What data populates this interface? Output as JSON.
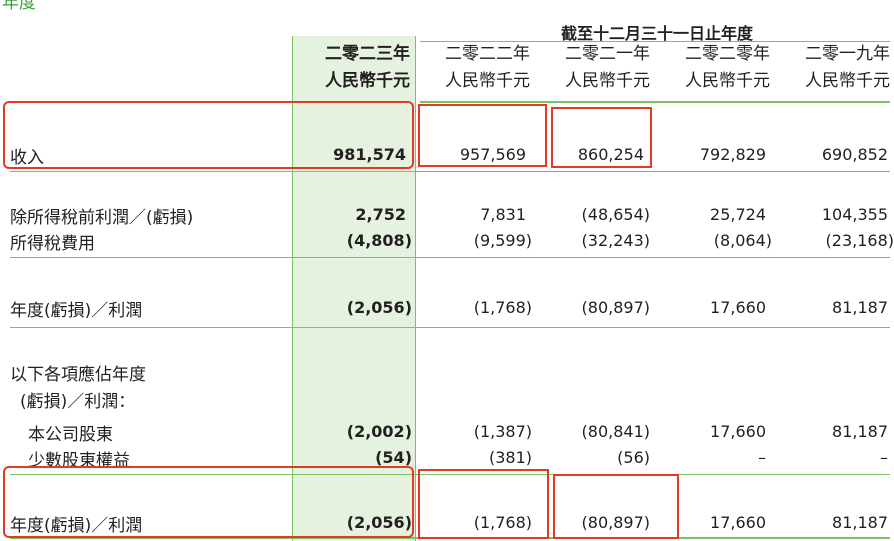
{
  "header": {
    "top_tag": "年度",
    "period_title": "截至十二月三十一日止年度",
    "columns": [
      {
        "year": "二零二三年",
        "unit": "人民幣千元",
        "highlight": true
      },
      {
        "year": "二零二二年",
        "unit": "人民幣千元",
        "highlight": false
      },
      {
        "year": "二零二一年",
        "unit": "人民幣千元",
        "highlight": false
      },
      {
        "year": "二零二零年",
        "unit": "人民幣千元",
        "highlight": false
      },
      {
        "year": "二零一九年",
        "unit": "人民幣千元",
        "highlight": false
      }
    ]
  },
  "rows": {
    "revenue": {
      "label": "收入",
      "values": [
        "981,574",
        "957,569",
        "860,254",
        "792,829",
        "690,852"
      ]
    },
    "profit_before_tax": {
      "label": "除所得稅前利潤／(虧損)",
      "values": [
        "2,752",
        "7,831",
        "(48,654)",
        "25,724",
        "104,355"
      ]
    },
    "income_tax": {
      "label": "所得稅費用",
      "values": [
        "(4,808)",
        "(9,599)",
        "(32,243)",
        "(8,064)",
        "(23,168)"
      ]
    },
    "year_result": {
      "label": "年度(虧損)／利潤",
      "values": [
        "(2,056)",
        "(1,768)",
        "(80,897)",
        "17,660",
        "81,187"
      ]
    },
    "attributable_heading_1": {
      "label": "以下各項應佔年度"
    },
    "attributable_heading_2": {
      "label": "(虧損)／利潤："
    },
    "owners": {
      "label": "本公司股東",
      "values": [
        "(2,002)",
        "(1,387)",
        "(80,841)",
        "17,660",
        "81,187"
      ]
    },
    "minority": {
      "label": "少數股東權益",
      "values": [
        "(54)",
        "(381)",
        "(56)",
        "–",
        "–"
      ]
    },
    "year_result_total": {
      "label": "年度(虧損)／利潤",
      "values": [
        "(2,056)",
        "(1,768)",
        "(80,897)",
        "17,660",
        "81,187"
      ]
    }
  },
  "colors": {
    "accent_green": "#7fbf68",
    "highlight_fill": "#e4f2df",
    "annotation_red": "#e23b22"
  }
}
